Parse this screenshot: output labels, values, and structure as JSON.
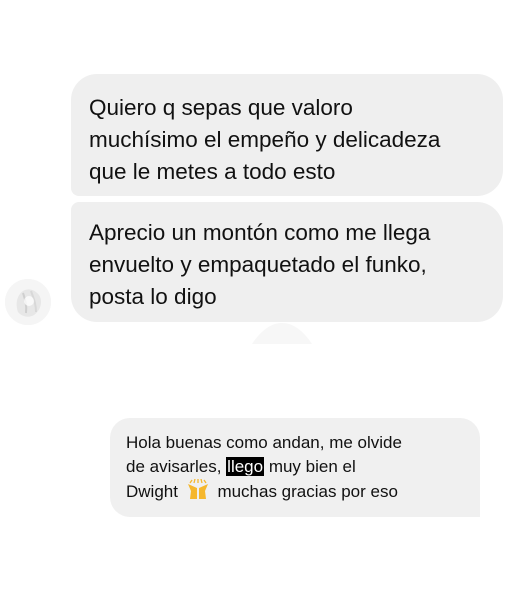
{
  "thread_top": {
    "message_1": {
      "line_1": "Quiero q sepas que valoro",
      "line_2": "muchísimo el empeño y delicadeza",
      "line_3": "que le metes a todo esto"
    },
    "message_2": {
      "line_1": "Aprecio un montón como me llega",
      "line_2": "envuelto y empaquetado el funko,",
      "line_3": "posta lo digo"
    }
  },
  "thread_bottom": {
    "message_3": {
      "line_1": "Hola buenas como andan, me olvide",
      "line_2_before": "de avisarles, ",
      "line_2_highlight": "llego",
      "line_2_after": " muy bien el",
      "line_3_before": "Dwight",
      "emoji": "raising-hands-emoji",
      "line_3_after": "muchas gracias por eso"
    }
  },
  "colors": {
    "bubble": "#efefef",
    "text": "#111111",
    "highlight_bg": "#000000",
    "highlight_text": "#ffffff",
    "emoji": "#f5b72d"
  }
}
